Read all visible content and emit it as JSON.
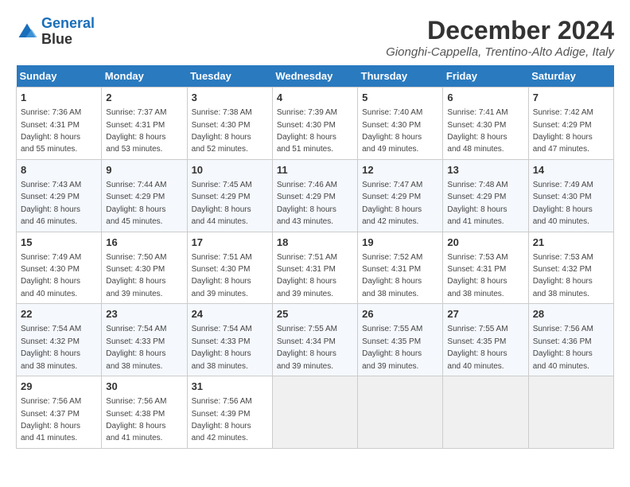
{
  "logo": {
    "line1": "General",
    "line2": "Blue"
  },
  "title": "December 2024",
  "subtitle": "Gionghi-Cappella, Trentino-Alto Adige, Italy",
  "headers": [
    "Sunday",
    "Monday",
    "Tuesday",
    "Wednesday",
    "Thursday",
    "Friday",
    "Saturday"
  ],
  "weeks": [
    [
      {
        "day": "1",
        "sunrise": "7:36 AM",
        "sunset": "4:31 PM",
        "daylight": "8 hours and 55 minutes."
      },
      {
        "day": "2",
        "sunrise": "7:37 AM",
        "sunset": "4:31 PM",
        "daylight": "8 hours and 53 minutes."
      },
      {
        "day": "3",
        "sunrise": "7:38 AM",
        "sunset": "4:30 PM",
        "daylight": "8 hours and 52 minutes."
      },
      {
        "day": "4",
        "sunrise": "7:39 AM",
        "sunset": "4:30 PM",
        "daylight": "8 hours and 51 minutes."
      },
      {
        "day": "5",
        "sunrise": "7:40 AM",
        "sunset": "4:30 PM",
        "daylight": "8 hours and 49 minutes."
      },
      {
        "day": "6",
        "sunrise": "7:41 AM",
        "sunset": "4:30 PM",
        "daylight": "8 hours and 48 minutes."
      },
      {
        "day": "7",
        "sunrise": "7:42 AM",
        "sunset": "4:29 PM",
        "daylight": "8 hours and 47 minutes."
      }
    ],
    [
      {
        "day": "8",
        "sunrise": "7:43 AM",
        "sunset": "4:29 PM",
        "daylight": "8 hours and 46 minutes."
      },
      {
        "day": "9",
        "sunrise": "7:44 AM",
        "sunset": "4:29 PM",
        "daylight": "8 hours and 45 minutes."
      },
      {
        "day": "10",
        "sunrise": "7:45 AM",
        "sunset": "4:29 PM",
        "daylight": "8 hours and 44 minutes."
      },
      {
        "day": "11",
        "sunrise": "7:46 AM",
        "sunset": "4:29 PM",
        "daylight": "8 hours and 43 minutes."
      },
      {
        "day": "12",
        "sunrise": "7:47 AM",
        "sunset": "4:29 PM",
        "daylight": "8 hours and 42 minutes."
      },
      {
        "day": "13",
        "sunrise": "7:48 AM",
        "sunset": "4:29 PM",
        "daylight": "8 hours and 41 minutes."
      },
      {
        "day": "14",
        "sunrise": "7:49 AM",
        "sunset": "4:30 PM",
        "daylight": "8 hours and 40 minutes."
      }
    ],
    [
      {
        "day": "15",
        "sunrise": "7:49 AM",
        "sunset": "4:30 PM",
        "daylight": "8 hours and 40 minutes."
      },
      {
        "day": "16",
        "sunrise": "7:50 AM",
        "sunset": "4:30 PM",
        "daylight": "8 hours and 39 minutes."
      },
      {
        "day": "17",
        "sunrise": "7:51 AM",
        "sunset": "4:30 PM",
        "daylight": "8 hours and 39 minutes."
      },
      {
        "day": "18",
        "sunrise": "7:51 AM",
        "sunset": "4:31 PM",
        "daylight": "8 hours and 39 minutes."
      },
      {
        "day": "19",
        "sunrise": "7:52 AM",
        "sunset": "4:31 PM",
        "daylight": "8 hours and 38 minutes."
      },
      {
        "day": "20",
        "sunrise": "7:53 AM",
        "sunset": "4:31 PM",
        "daylight": "8 hours and 38 minutes."
      },
      {
        "day": "21",
        "sunrise": "7:53 AM",
        "sunset": "4:32 PM",
        "daylight": "8 hours and 38 minutes."
      }
    ],
    [
      {
        "day": "22",
        "sunrise": "7:54 AM",
        "sunset": "4:32 PM",
        "daylight": "8 hours and 38 minutes."
      },
      {
        "day": "23",
        "sunrise": "7:54 AM",
        "sunset": "4:33 PM",
        "daylight": "8 hours and 38 minutes."
      },
      {
        "day": "24",
        "sunrise": "7:54 AM",
        "sunset": "4:33 PM",
        "daylight": "8 hours and 38 minutes."
      },
      {
        "day": "25",
        "sunrise": "7:55 AM",
        "sunset": "4:34 PM",
        "daylight": "8 hours and 39 minutes."
      },
      {
        "day": "26",
        "sunrise": "7:55 AM",
        "sunset": "4:35 PM",
        "daylight": "8 hours and 39 minutes."
      },
      {
        "day": "27",
        "sunrise": "7:55 AM",
        "sunset": "4:35 PM",
        "daylight": "8 hours and 40 minutes."
      },
      {
        "day": "28",
        "sunrise": "7:56 AM",
        "sunset": "4:36 PM",
        "daylight": "8 hours and 40 minutes."
      }
    ],
    [
      {
        "day": "29",
        "sunrise": "7:56 AM",
        "sunset": "4:37 PM",
        "daylight": "8 hours and 41 minutes."
      },
      {
        "day": "30",
        "sunrise": "7:56 AM",
        "sunset": "4:38 PM",
        "daylight": "8 hours and 41 minutes."
      },
      {
        "day": "31",
        "sunrise": "7:56 AM",
        "sunset": "4:39 PM",
        "daylight": "8 hours and 42 minutes."
      },
      null,
      null,
      null,
      null
    ]
  ],
  "labels": {
    "sunrise": "Sunrise:",
    "sunset": "Sunset:",
    "daylight": "Daylight hours"
  }
}
